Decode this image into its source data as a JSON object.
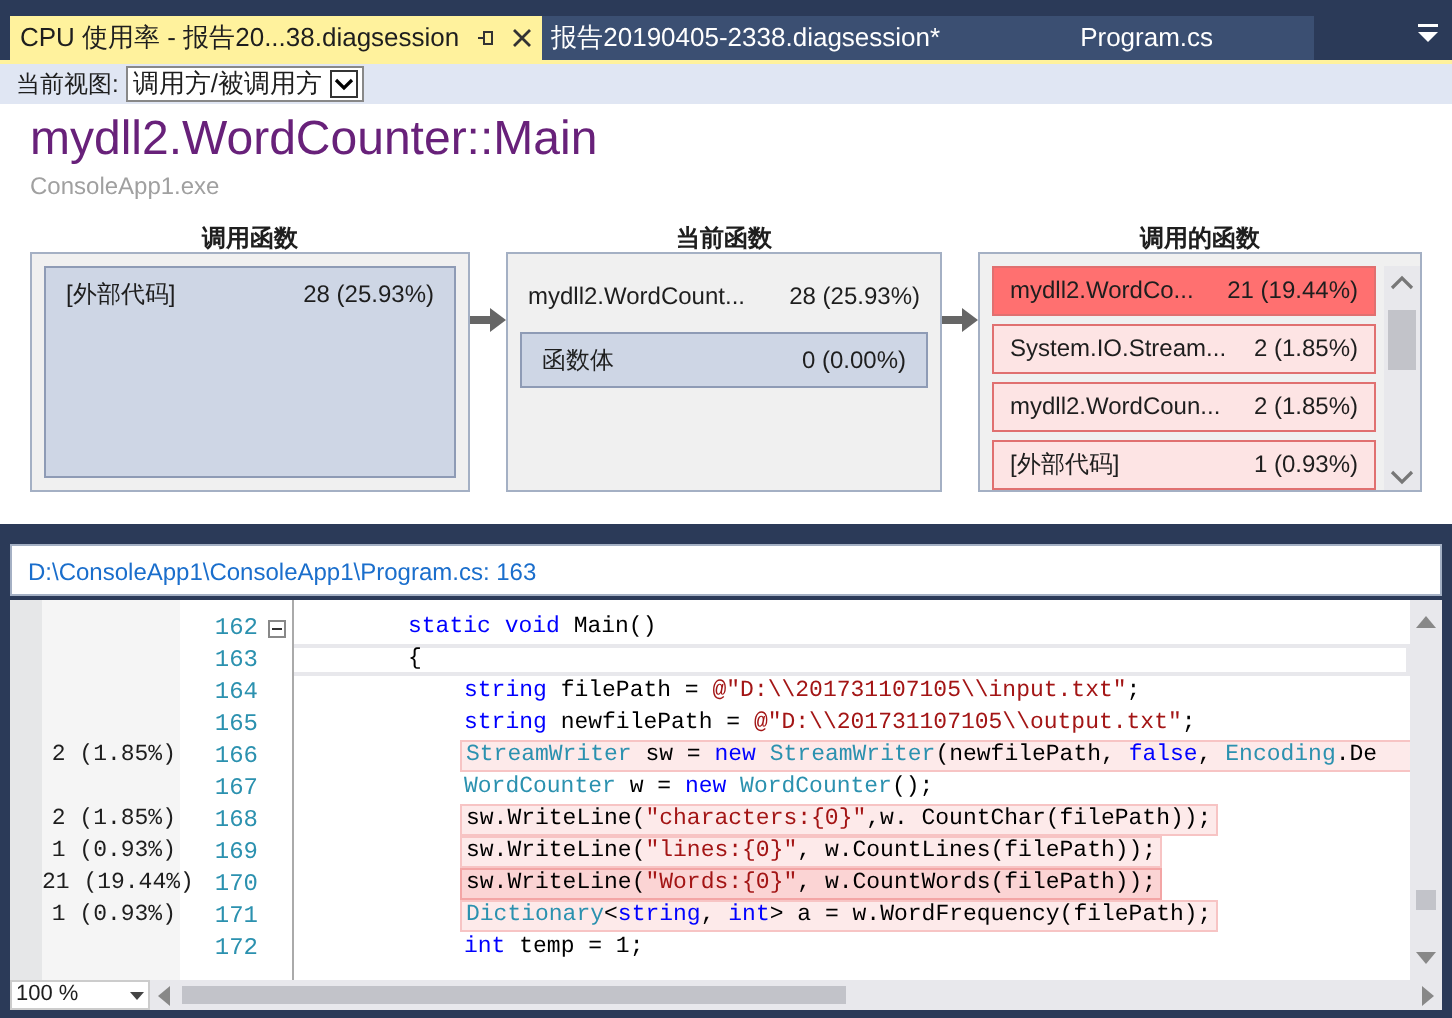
{
  "tabs": [
    {
      "label": "CPU 使用率 - 报告20...38.diagsession",
      "selected": true,
      "pinned": true
    },
    {
      "label": "报告20190405-2338.diagsession*",
      "selected": false,
      "pinned": false
    },
    {
      "label": "Program.cs",
      "selected": false,
      "pinned": false
    }
  ],
  "toolbar": {
    "label": "当前视图:",
    "view": "调用方/被调用方"
  },
  "function": {
    "title": "mydll2.WordCounter::Main",
    "module": "ConsoleApp1.exe"
  },
  "callers": {
    "heading": "调用函数",
    "items": [
      {
        "name": "[外部代码]",
        "value": "28 (25.93%)"
      }
    ]
  },
  "current": {
    "heading": "当前函数",
    "name": "mydll2.WordCount...",
    "value": "28 (25.93%)",
    "body": {
      "name": "函数体",
      "value": "0 (0.00%)"
    }
  },
  "callees": {
    "heading": "调用的函数",
    "items": [
      {
        "name": "mydll2.WordCo...",
        "value": "21 (19.44%)",
        "color": "#ff7070"
      },
      {
        "name": "System.IO.Stream...",
        "value": "2 (1.85%)",
        "color": "#fde4e4"
      },
      {
        "name": "mydll2.WordCoun...",
        "value": "2 (1.85%)",
        "color": "#fde4e4"
      },
      {
        "name": "[外部代码]",
        "value": "1 (0.93%)",
        "color": "#fde4e4"
      }
    ]
  },
  "source_path": "D:\\ConsoleApp1\\ConsoleApp1\\Program.cs: 163",
  "code_lines": [
    {
      "number": "162",
      "inner": false,
      "current": false,
      "collapsible": true,
      "tokens": [
        {
          "t": "static ",
          "kind": "kw"
        },
        {
          "t": "void",
          "kind": "kw"
        },
        {
          "t": " Main()",
          "kind": "plain"
        }
      ]
    },
    {
      "number": "163",
      "inner": false,
      "current": true,
      "collapsible": false,
      "tokens": [
        {
          "t": "{",
          "kind": "plain"
        }
      ]
    },
    {
      "number": "164",
      "inner": true,
      "current": false,
      "collapsible": false,
      "tokens": [
        {
          "t": "string",
          "kind": "kw"
        },
        {
          "t": " filePath = ",
          "kind": "plain"
        },
        {
          "t": "@\"D:\\\\201731107105\\\\input.txt\"",
          "kind": "str"
        },
        {
          "t": ";",
          "kind": "plain"
        }
      ]
    },
    {
      "number": "165",
      "inner": true,
      "current": false,
      "collapsible": false,
      "tokens": [
        {
          "t": "string",
          "kind": "kw"
        },
        {
          "t": " newfilePath = ",
          "kind": "plain"
        },
        {
          "t": "@\"D:\\\\201731107105\\\\output.txt\"",
          "kind": "str"
        },
        {
          "t": ";",
          "kind": "plain"
        }
      ]
    },
    {
      "number": "166",
      "hits": "2 (1.85%)",
      "highlighted": true,
      "strong": false,
      "wide": true,
      "inner": true,
      "current": false,
      "collapsible": false,
      "tokens": [
        {
          "t": "StreamWriter",
          "kind": "type"
        },
        {
          "t": " sw = ",
          "kind": "plain"
        },
        {
          "t": "new ",
          "kind": "kw"
        },
        {
          "t": "StreamWriter",
          "kind": "type"
        },
        {
          "t": "(newfilePath, ",
          "kind": "plain"
        },
        {
          "t": "false",
          "kind": "kw"
        },
        {
          "t": ", ",
          "kind": "plain"
        },
        {
          "t": "Encoding",
          "kind": "type"
        },
        {
          "t": ".De",
          "kind": "plain"
        }
      ]
    },
    {
      "number": "167",
      "inner": true,
      "current": false,
      "collapsible": false,
      "tokens": [
        {
          "t": "WordCounter",
          "kind": "type"
        },
        {
          "t": " w = ",
          "kind": "plain"
        },
        {
          "t": "new ",
          "kind": "kw"
        },
        {
          "t": "WordCounter",
          "kind": "type"
        },
        {
          "t": "();",
          "kind": "plain"
        }
      ]
    },
    {
      "number": "168",
      "hits": "2 (1.85%)",
      "highlighted": true,
      "strong": false,
      "inner": true,
      "current": false,
      "collapsible": false,
      "tokens": [
        {
          "t": "sw.WriteLine(",
          "kind": "plain"
        },
        {
          "t": "\"characters:{0}\"",
          "kind": "str"
        },
        {
          "t": ",w. CountChar(filePath));",
          "kind": "plain"
        }
      ]
    },
    {
      "number": "169",
      "hits": "1 (0.93%)",
      "highlighted": true,
      "strong": false,
      "inner": true,
      "current": false,
      "collapsible": false,
      "tokens": [
        {
          "t": "sw.WriteLine(",
          "kind": "plain"
        },
        {
          "t": "\"lines:{0}\"",
          "kind": "str"
        },
        {
          "t": ", w.CountLines(filePath));",
          "kind": "plain"
        }
      ]
    },
    {
      "number": "170",
      "hits": "21 (19.44%)",
      "highlighted": true,
      "strong": true,
      "inner": true,
      "current": false,
      "collapsible": false,
      "tokens": [
        {
          "t": "sw.WriteLine(",
          "kind": "plain"
        },
        {
          "t": "\"Words:{0}\"",
          "kind": "str"
        },
        {
          "t": ", w.CountWords(filePath));",
          "kind": "plain"
        }
      ]
    },
    {
      "number": "171",
      "hits": "1 (0.93%)",
      "highlighted": true,
      "strong": false,
      "inner": true,
      "current": false,
      "collapsible": false,
      "tokens": [
        {
          "t": "Dictionary",
          "kind": "type"
        },
        {
          "t": "<",
          "kind": "plain"
        },
        {
          "t": "string",
          "kind": "kw"
        },
        {
          "t": ", ",
          "kind": "plain"
        },
        {
          "t": "int",
          "kind": "kw"
        },
        {
          "t": "> a = w.WordFrequency(filePath);",
          "kind": "plain"
        }
      ]
    },
    {
      "number": "172",
      "inner": true,
      "current": false,
      "collapsible": false,
      "tokens": [
        {
          "t": "int",
          "kind": "kw"
        },
        {
          "t": " temp = 1;",
          "kind": "plain"
        }
      ]
    }
  ],
  "zoom": "100 %"
}
